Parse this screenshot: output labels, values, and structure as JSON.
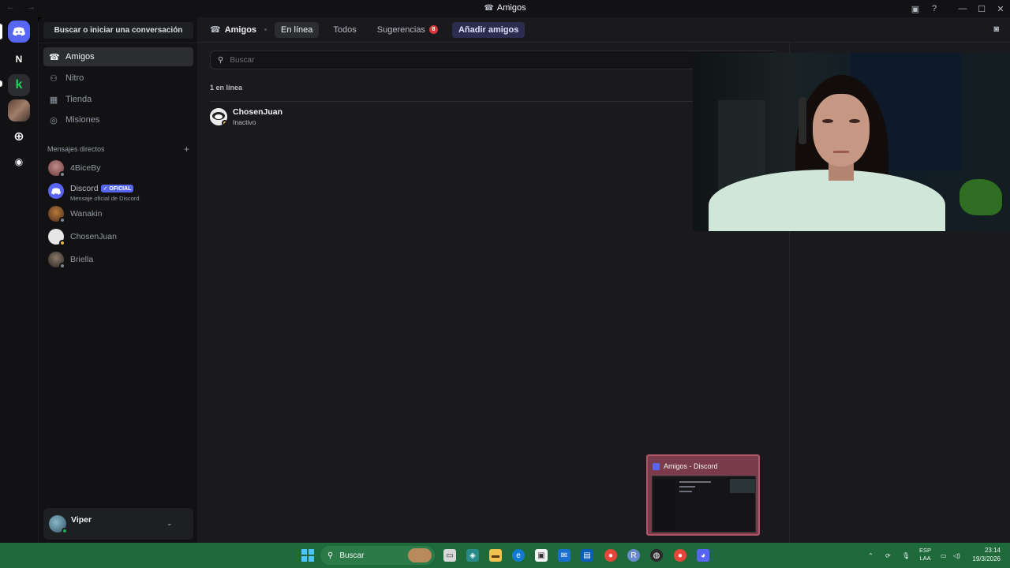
{
  "window": {
    "title": "Amigos",
    "nav_arrows": "← →"
  },
  "guilds": {
    "n_label": "N"
  },
  "sidebar": {
    "search_label": "Buscar o iniciar una conversación",
    "nav": [
      {
        "label": "Amigos",
        "icon": "friends-icon"
      },
      {
        "label": "Nitro",
        "icon": "nitro-icon"
      },
      {
        "label": "Tienda",
        "icon": "shop-icon"
      },
      {
        "label": "Misiones",
        "icon": "quests-icon"
      }
    ],
    "dm_header": "Mensajes directos",
    "dms": [
      {
        "name": "4BiceBy",
        "color": "#8a5a5a"
      },
      {
        "name": "Discord",
        "badge": "✓ OFICIAL",
        "sub": "Mensaje oficial de Discord",
        "color": "#5865f2"
      },
      {
        "name": "Wanakin",
        "color": "#7a4a2a"
      },
      {
        "name": "ChosenJuan",
        "color": "#e6e6e6"
      },
      {
        "name": "Briella",
        "color": "#5a5048"
      }
    ]
  },
  "user": {
    "name": "Viper"
  },
  "topbar": {
    "friends_label": "Amigos",
    "tabs": {
      "online": "En línea",
      "all": "Todos",
      "suggestions": "Sugerencias",
      "suggestions_count": "8",
      "add": "Añadir amigos"
    }
  },
  "main": {
    "search_placeholder": "Buscar",
    "count_label": "1 en línea",
    "friends": [
      {
        "name": "ChosenJuan",
        "status": "Inactivo"
      }
    ]
  },
  "preview": {
    "title": "Amigos - Discord"
  },
  "taskbar": {
    "search_label": "Buscar",
    "lang_line1": "ESP",
    "lang_line2": "LAA",
    "time": "23:14",
    "date": "19/3/2026"
  },
  "colors": {
    "accent": "#5865f2",
    "taskbar": "#1e6a3a",
    "idle": "#f0b232",
    "online": "#23a55a"
  }
}
